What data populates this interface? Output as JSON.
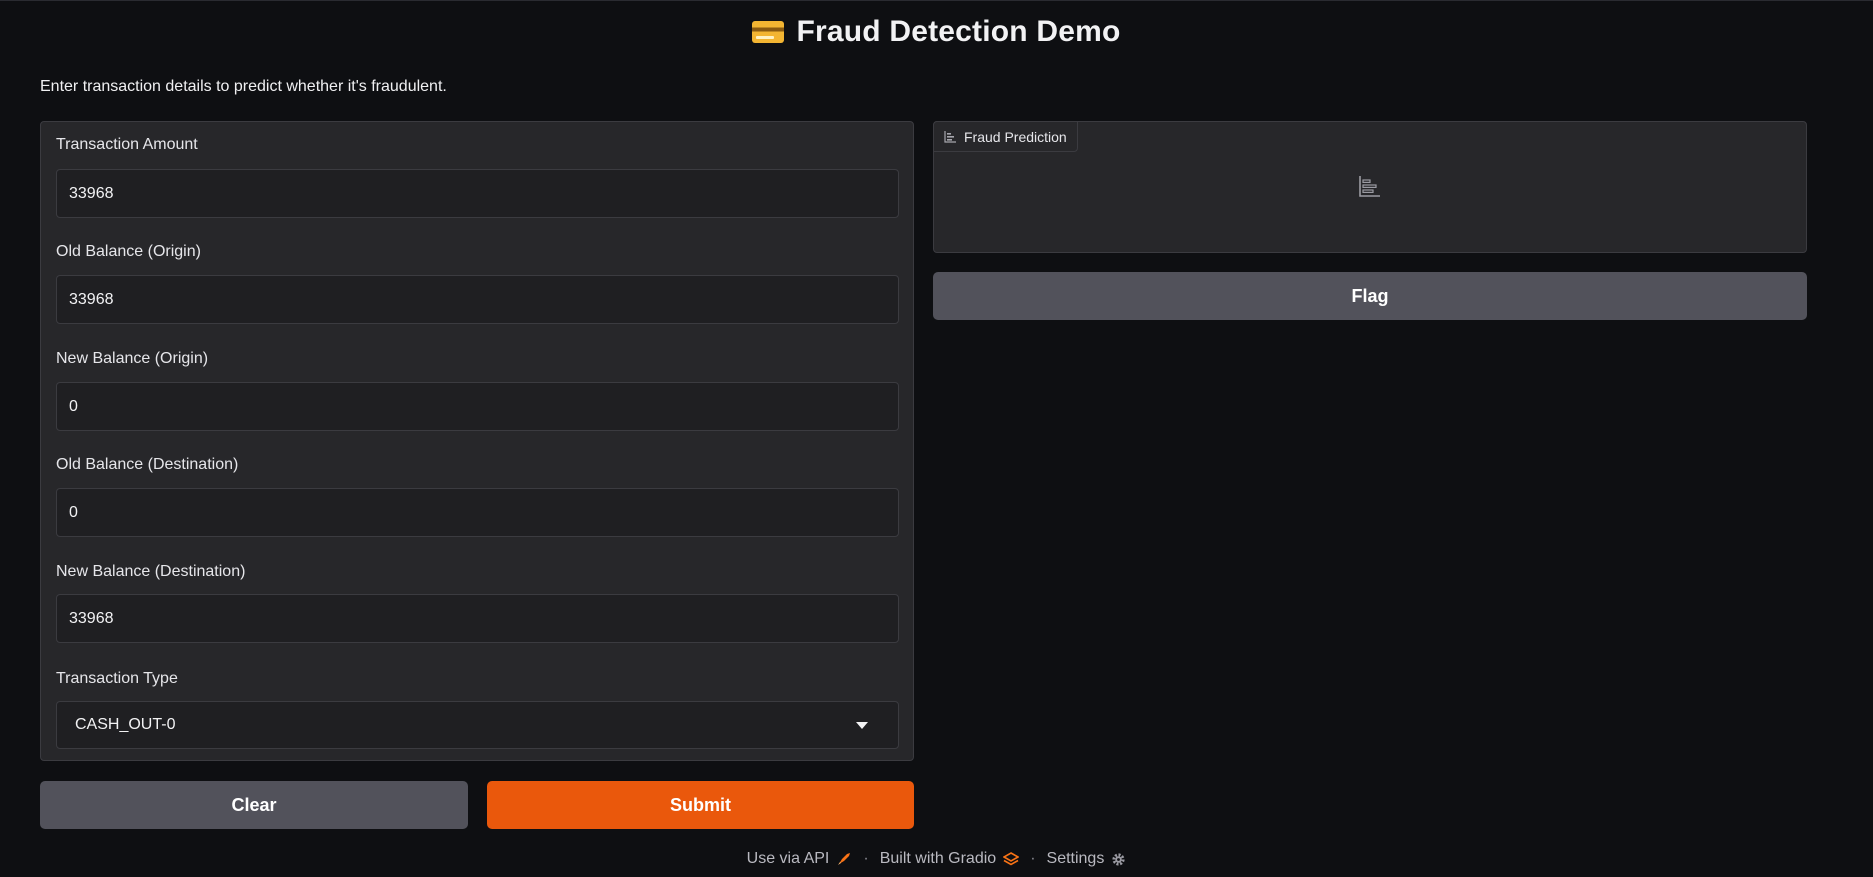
{
  "header": {
    "title": "Fraud Detection Demo",
    "icon": "credit-card-icon",
    "description": "Enter transaction details to predict whether it's fraudulent."
  },
  "inputs": {
    "transaction_amount": {
      "label": "Transaction Amount",
      "value": "33968"
    },
    "old_balance_origin": {
      "label": "Old Balance (Origin)",
      "value": "33968"
    },
    "new_balance_origin": {
      "label": "New Balance (Origin)",
      "value": "0"
    },
    "old_balance_destination": {
      "label": "Old Balance (Destination)",
      "value": "0"
    },
    "new_balance_destination": {
      "label": "New Balance (Destination)",
      "value": "33968"
    },
    "transaction_type": {
      "label": "Transaction Type",
      "value": "CASH_OUT-0"
    }
  },
  "buttons": {
    "clear": "Clear",
    "submit": "Submit",
    "flag": "Flag"
  },
  "output": {
    "label": "Fraud Prediction",
    "icon": "bar-chart-icon"
  },
  "footer": {
    "api": "Use via API",
    "built": "Built with Gradio",
    "settings": "Settings"
  },
  "colors": {
    "background": "#0e0f12",
    "panel": "#27272a",
    "input": "#1f1f22",
    "secondary_button": "#52525b",
    "primary_button": "#ea580c"
  }
}
